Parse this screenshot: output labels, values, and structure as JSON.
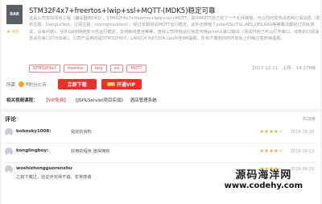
{
  "resource": {
    "thumb_label": "RAR",
    "rating_stars": "★",
    "rating_label": "4分",
    "title": "STM32F4x7+freertos+lwip+ssl+MQTT-(MDK5)稳定可靠",
    "description": "这是公司实际项目工程（编译器用DK5），STM32F4x7+freertos+lwip+ssl+MQTT，其中MQTT自己花了一个礼拜移植，可以同时发布消息和订阅消息（发布主题：DongLoTest，订阅主题：mymqttsubtest），经过长期测试MQTT运行稳定。此外还移植了polarSSL(TSL,AES,DES,RAS等等算法都经过项目测试，没有问题)，另外LWIP网络部分也运行稳定，支持断线重连等等，曾经公司所有运行信息可用printf从串口输出（测试时自己可以打开串口，收到的订阅消息会在串口打印出来）。公司产品用的是STM32F407，LAN芯片为8720A,cpu外挂8M晶振，所有下载到你的开发板上时稍注意时钟晶振。",
    "tags": [
      "STM32F4x7",
      "freertos",
      "lwip",
      "ssl",
      "MQTT"
    ],
    "date": "2017-12-11",
    "downloads": "上传",
    "size": "14.37MB",
    "price_label": "所需",
    "price_value": "8",
    "price_unit": "积分/C币",
    "download_button": "立即下载",
    "vip_badge": "VIP",
    "vip_button": "开通VIP"
  },
  "course": {
    "label": "相关视频课程：",
    "vip_tag": "【VIP免费】",
    "items": [
      "《JSP&Servlet项目实战》",
      "酒店管理系统"
    ]
  },
  "comments": {
    "title": "评论",
    "count": "共28条",
    "list": [
      {
        "name": "bobosky1008",
        "text": "挺好的资料",
        "stars": 4,
        "date": "2018-10-16"
      },
      {
        "name": "konglingboy",
        "text": "好用的程序,值得拥有.",
        "stars": 4,
        "date": "2018-10-13"
      },
      {
        "name": "woshizhongguorenzhu",
        "text": "之前下载过，验证步完得不错，非常感谢",
        "stars": 4,
        "date": "2018-09-29"
      }
    ]
  },
  "watermark": {
    "cn": "源码海洋网",
    "url": "www.codehy.com"
  },
  "colors": {
    "accent": "#e8312b",
    "star": "#f4a21a"
  }
}
